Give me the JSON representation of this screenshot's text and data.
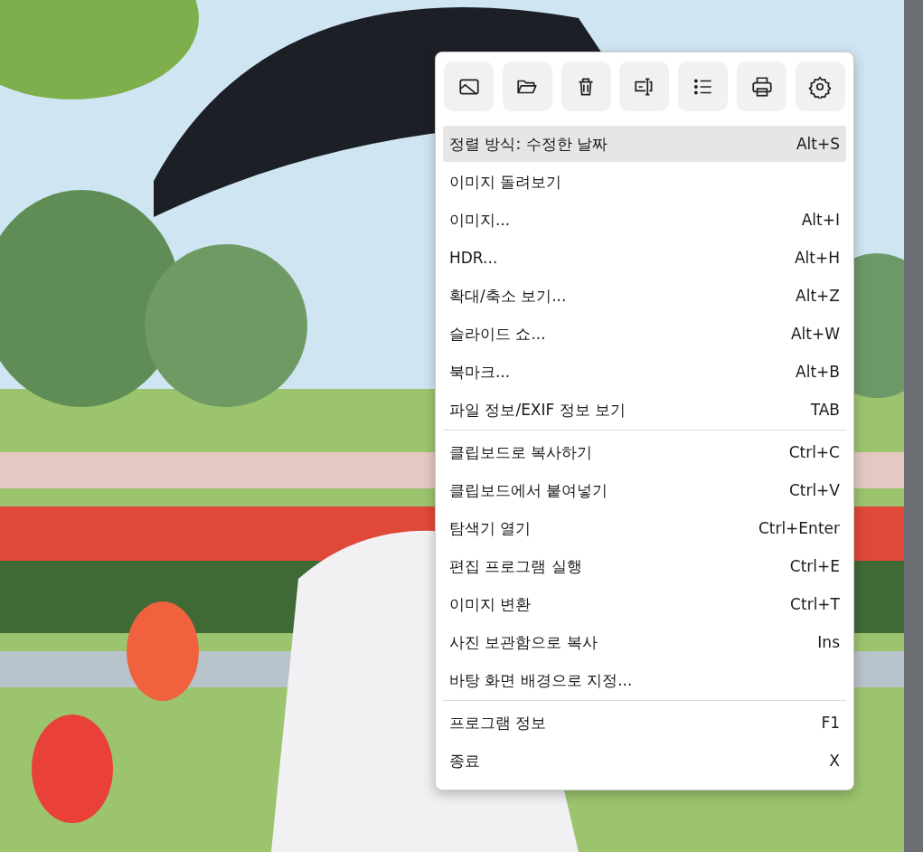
{
  "menu": {
    "groups": [
      {
        "items": [
          {
            "label": "정렬 방식: 수정한 날짜",
            "shortcut": "Alt+S",
            "selected": true
          },
          {
            "label": "이미지 돌려보기",
            "selected": false
          },
          {
            "label": "이미지...",
            "shortcut": "Alt+I",
            "selected": false
          },
          {
            "label": "HDR...",
            "shortcut": "Alt+H",
            "selected": false
          },
          {
            "label": "확대/축소 보기...",
            "shortcut": "Alt+Z",
            "selected": false
          },
          {
            "label": "슬라이드 쇼...",
            "shortcut": "Alt+W",
            "selected": false
          },
          {
            "label": "북마크...",
            "shortcut": "Alt+B",
            "selected": false
          },
          {
            "label": "파일 정보/EXIF 정보 보기",
            "shortcut": "TAB",
            "selected": false
          }
        ]
      },
      {
        "items": [
          {
            "label": "클립보드로 복사하기",
            "shortcut": "Ctrl+C",
            "selected": false
          },
          {
            "label": "클립보드에서 붙여넣기",
            "shortcut": "Ctrl+V",
            "selected": false
          },
          {
            "label": "탐색기 열기",
            "shortcut": "Ctrl+Enter",
            "selected": false
          },
          {
            "label": "편집 프로그램 실행",
            "shortcut": "Ctrl+E",
            "selected": false
          },
          {
            "label": "이미지 변환",
            "shortcut": "Ctrl+T",
            "selected": false
          },
          {
            "label": "사진 보관함으로 복사",
            "shortcut": "Ins",
            "selected": false
          },
          {
            "label": "바탕 화면 배경으로 지정...",
            "selected": false
          }
        ]
      },
      {
        "items": [
          {
            "label": "프로그램 정보",
            "shortcut": "F1",
            "selected": false
          },
          {
            "label": "종료",
            "shortcut": "X",
            "selected": false
          }
        ]
      }
    ]
  }
}
